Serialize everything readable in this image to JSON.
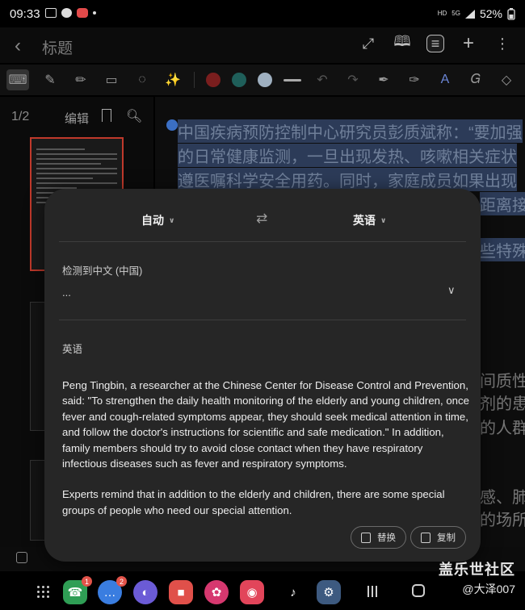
{
  "status_bar": {
    "time": "09:33",
    "network": "HD",
    "network_gen": "5G",
    "battery": "52%"
  },
  "title_bar": {
    "title": "标题"
  },
  "toolbar": {
    "colors": [
      "#7a1e1e",
      "#1f5f5a",
      "#9fb0c0"
    ]
  },
  "side_panel": {
    "page_indicator": "1/2",
    "edit_label": "编辑"
  },
  "canvas": {
    "lines": [
      "中国疾病预防控制中心研究员彭质斌称：“要加强",
      "的日常健康监测，一旦出现发热、咳嗽相关症状",
      "遵医嘱科学安全用药。同时，家庭成员如果出现"
    ],
    "fragments": [
      "距离接",
      "些特殊",
      "间质性",
      "剂的患",
      "的人群",
      "感、肺",
      "的场所"
    ]
  },
  "dialog": {
    "source_language": "自动",
    "target_language": "英语",
    "detected_label": "检测到中文 (中国)",
    "source_text": "...",
    "target_label": "英语",
    "translation": [
      "Peng Tingbin, a researcher at the Chinese Center for Disease Control and Prevention, said: \"To strengthen the daily health monitoring of the elderly and young children, once fever and cough-related symptoms appear, they should seek medical attention in time, and follow the doctor's instructions for scientific and safe medication.\" In addition, family members should try to avoid close contact when they have respiratory infectious diseases such as fever and respiratory symptoms.",
      "Experts remind that in addition to the elderly and children, there are some special groups of people who need our special attention."
    ],
    "replace_label": "替换",
    "copy_label": "复制"
  },
  "dock": {
    "phone_badge": "1",
    "messages_badge": "2"
  },
  "watermark": {
    "line1": "盖乐世社区",
    "line2": "@大泽007"
  }
}
